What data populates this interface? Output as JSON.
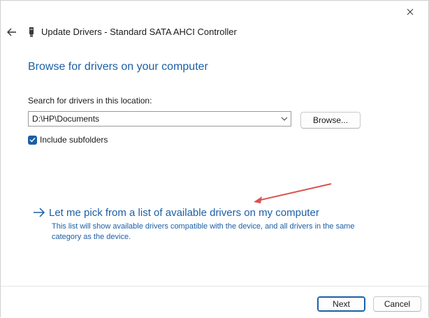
{
  "window": {
    "title": "Update Drivers - Standard SATA AHCI Controller"
  },
  "main": {
    "heading": "Browse for drivers on your computer",
    "search_label": "Search for drivers in this location:",
    "path_value": "D:\\HP\\Documents",
    "browse_label": "Browse...",
    "include_subfolders_label": "Include subfolders",
    "include_subfolders_checked": true,
    "pick_link": "Let me pick from a list of available drivers on my computer",
    "pick_description": "This list will show available drivers compatible with the device, and all drivers in the same category as the device."
  },
  "footer": {
    "next_label": "Next",
    "cancel_label": "Cancel"
  },
  "colors": {
    "accent": "#1b5fa6",
    "annotation_arrow": "#d9534f"
  },
  "icons": {
    "close": "close-icon",
    "back": "back-arrow-icon",
    "device": "device-icon",
    "dropdown": "chevron-down-icon",
    "check": "checkmark-icon",
    "link_arrow": "right-arrow-icon"
  }
}
